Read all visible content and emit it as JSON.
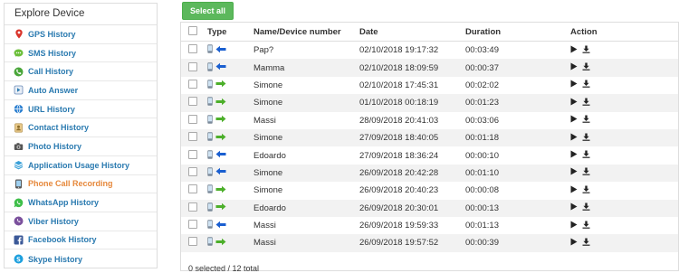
{
  "sidebar": {
    "title": "Explore Device",
    "items": [
      {
        "label": "GPS History",
        "icon": "map-pin-icon"
      },
      {
        "label": "SMS History",
        "icon": "sms-icon"
      },
      {
        "label": "Call History",
        "icon": "phone-call-icon"
      },
      {
        "label": "Auto Answer",
        "icon": "auto-answer-icon"
      },
      {
        "label": "URL History",
        "icon": "globe-icon"
      },
      {
        "label": "Contact History",
        "icon": "contact-book-icon"
      },
      {
        "label": "Photo History",
        "icon": "camera-icon"
      },
      {
        "label": "Application Usage History",
        "icon": "app-stack-icon"
      },
      {
        "label": "Phone Call Recording",
        "icon": "call-recording-icon",
        "active": true
      },
      {
        "label": "WhatsApp History",
        "icon": "whatsapp-icon"
      },
      {
        "label": "Viber History",
        "icon": "viber-icon"
      },
      {
        "label": "Facebook History",
        "icon": "facebook-icon"
      },
      {
        "label": "Skype History",
        "icon": "skype-icon"
      }
    ]
  },
  "toolbar": {
    "select_all_label": "Select all"
  },
  "table": {
    "headers": {
      "type": "Type",
      "name": "Name/Device number",
      "date": "Date",
      "duration": "Duration",
      "action": "Action"
    },
    "rows": [
      {
        "name": "Pap?",
        "date": "02/10/2018 19:17:32",
        "duration": "00:03:49",
        "direction": "incoming"
      },
      {
        "name": "Mamma",
        "date": "02/10/2018 18:09:59",
        "duration": "00:00:37",
        "direction": "incoming"
      },
      {
        "name": "Simone",
        "date": "02/10/2018 17:45:31",
        "duration": "00:02:02",
        "direction": "outgoing"
      },
      {
        "name": "Simone",
        "date": "01/10/2018 00:18:19",
        "duration": "00:01:23",
        "direction": "outgoing"
      },
      {
        "name": "Massi",
        "date": "28/09/2018 20:41:03",
        "duration": "00:03:06",
        "direction": "outgoing"
      },
      {
        "name": "Simone",
        "date": "27/09/2018 18:40:05",
        "duration": "00:01:18",
        "direction": "outgoing"
      },
      {
        "name": "Edoardo",
        "date": "27/09/2018 18:36:24",
        "duration": "00:00:10",
        "direction": "incoming"
      },
      {
        "name": "Simone",
        "date": "26/09/2018 20:42:28",
        "duration": "00:01:10",
        "direction": "incoming"
      },
      {
        "name": "Simone",
        "date": "26/09/2018 20:40:23",
        "duration": "00:00:08",
        "direction": "outgoing"
      },
      {
        "name": "Edoardo",
        "date": "26/09/2018 20:30:01",
        "duration": "00:00:13",
        "direction": "outgoing"
      },
      {
        "name": "Massi",
        "date": "26/09/2018 19:59:33",
        "duration": "00:01:13",
        "direction": "incoming"
      },
      {
        "name": "Massi",
        "date": "26/09/2018 19:57:52",
        "duration": "00:00:39",
        "direction": "outgoing"
      }
    ]
  },
  "footer": {
    "status": "0 selected / 12 total"
  },
  "colors": {
    "accent": "#5cb85c",
    "link": "#2a7ab0",
    "active": "#e6883b",
    "incoming": "#1a5fd0",
    "outgoing": "#4caf2a"
  }
}
